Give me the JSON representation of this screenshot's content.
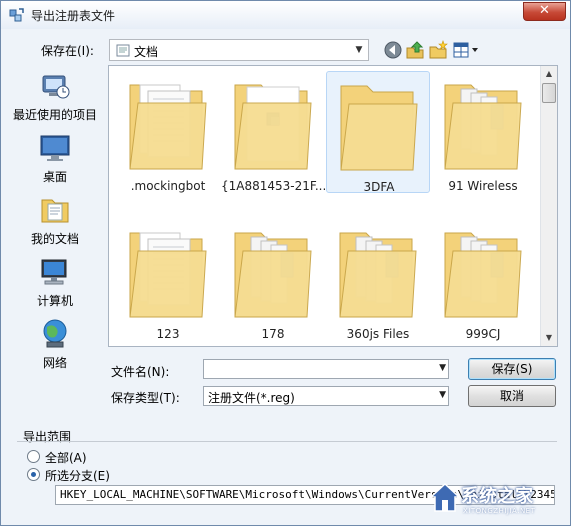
{
  "window": {
    "title": "导出注册表文件",
    "close_label": "✕"
  },
  "toolbar": {
    "save_in_label": "保存在(I):",
    "save_in_value": "文档",
    "icons": [
      "back-icon",
      "up-folder-icon",
      "new-folder-icon",
      "view-menu-icon"
    ]
  },
  "places": [
    {
      "label": "最近使用的项目",
      "icon": "recent-items-icon"
    },
    {
      "label": "桌面",
      "icon": "desktop-icon"
    },
    {
      "label": "我的文档",
      "icon": "documents-icon"
    },
    {
      "label": "计算机",
      "icon": "computer-icon"
    },
    {
      "label": "网络",
      "icon": "network-icon"
    }
  ],
  "files": [
    {
      "name": ".mockingbot",
      "variant": "papers"
    },
    {
      "name": "{1A881453-21F...",
      "variant": "setup"
    },
    {
      "name": "3DFA",
      "variant": "empty",
      "selected": true
    },
    {
      "name": "91 Wireless",
      "variant": "docs"
    },
    {
      "name": "123",
      "variant": "papers"
    },
    {
      "name": "178",
      "variant": "docs"
    },
    {
      "name": "360js Files",
      "variant": "docs"
    },
    {
      "name": "999CJ",
      "variant": "docs"
    }
  ],
  "form": {
    "filename_label": "文件名(N):",
    "filename_value": "",
    "filetype_label": "保存类型(T):",
    "filetype_value": "注册文件(*.reg)",
    "save_button": "保存(S)",
    "cancel_button": "取消"
  },
  "export_range": {
    "title": "导出范围",
    "all_label": "全部(A)",
    "branch_label": "所选分支(E)",
    "selected": "branch",
    "branch_value": "HKEY_LOCAL_MACHINE\\SOFTWARE\\Microsoft\\Windows\\CurrentVersion\\Uninstall\\2345"
  },
  "watermark": {
    "text": "系统之家",
    "sub": "XITONGZHIJIA.NET"
  },
  "colors": {
    "folder": "#f3d27a",
    "accent": "#3c7fb1",
    "selection": "#e8f2fc"
  }
}
